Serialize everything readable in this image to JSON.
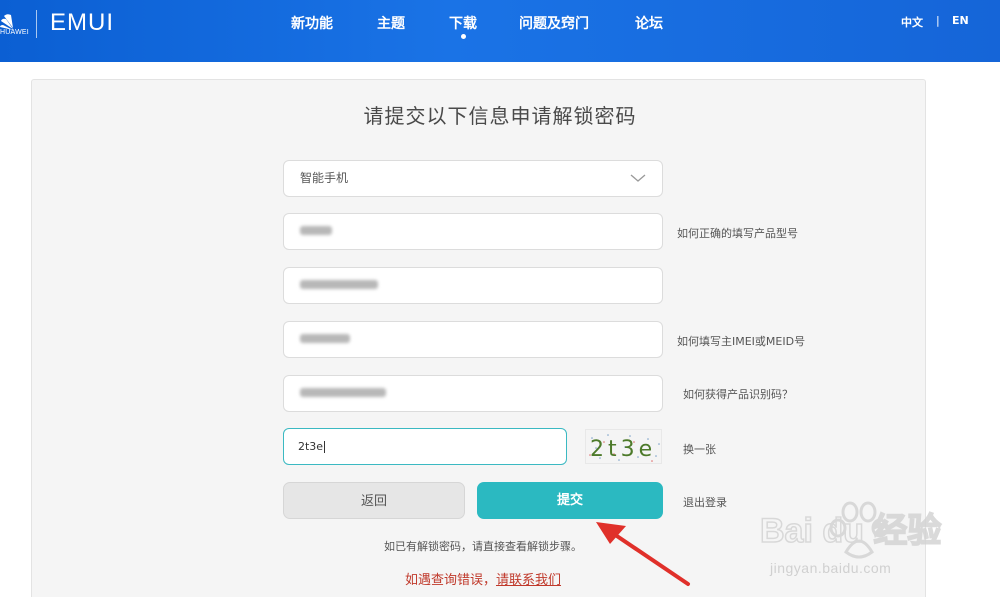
{
  "header": {
    "brand_small": "HUAWEI",
    "brand": "EMUI",
    "nav": [
      {
        "label": "新功能"
      },
      {
        "label": "主题"
      },
      {
        "label": "下载"
      },
      {
        "label": "问题及窍门"
      },
      {
        "label": "论坛"
      }
    ],
    "active_nav": "下载",
    "lang_zh": "中文",
    "lang_sep": "|",
    "lang_en": "EN"
  },
  "form": {
    "title": "请提交以下信息申请解锁密码",
    "device_type": "智能手机",
    "model_help": "如何正确的填写产品型号",
    "imei_help": "如何填写主IMEI或MEID号",
    "product_id_help": "如何获得产品识别码？",
    "captcha_value": "2t3e",
    "captcha_text": "2t3e",
    "captcha_refresh": "换一张",
    "back_label": "返回",
    "submit_label": "提交",
    "logout_label": "退出登录",
    "note": "如已有解锁密码，请直接查看解锁步骤。",
    "contact_prefix": "如遇查询错误，",
    "contact_link": "请联系我们"
  },
  "watermark": {
    "text": "jingyan.baidu.com",
    "logo": "Bai du 经验"
  },
  "colors": {
    "header_blue": "#1a73e6",
    "submit_teal": "#2bb9c1",
    "contact_red": "#c0392b",
    "arrow_red": "#e0302a"
  }
}
